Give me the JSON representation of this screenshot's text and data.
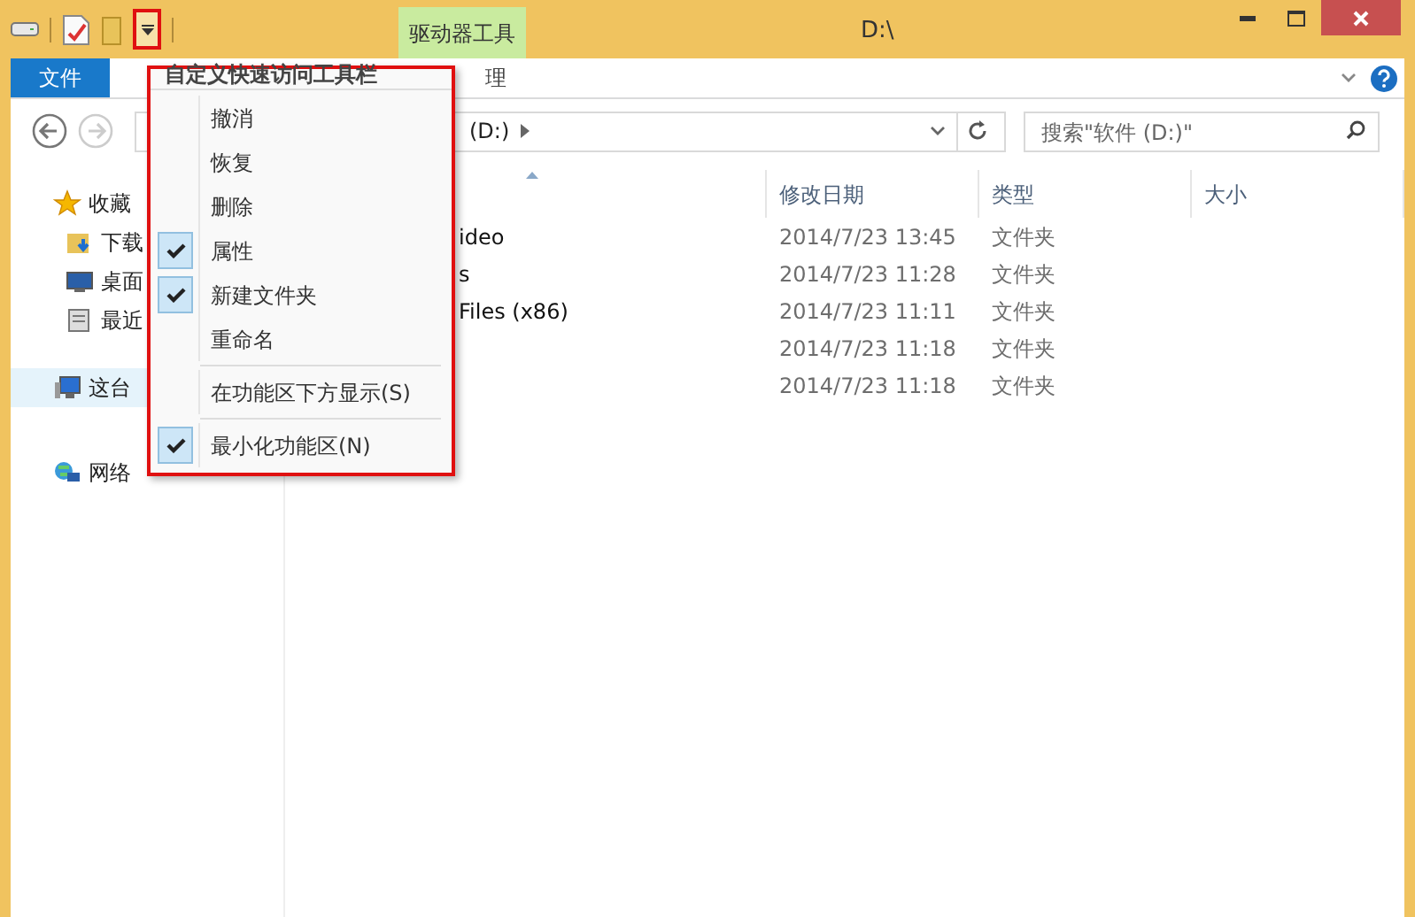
{
  "window": {
    "title": "D:\\",
    "context_tab": "驱动器工具"
  },
  "ribbon_tabs": [
    {
      "label": "文件",
      "selected": true
    },
    {
      "label": "理",
      "selected": false
    }
  ],
  "address": {
    "path": "(D:)",
    "search_placeholder": "搜索\"软件 (D:)\""
  },
  "nav": [
    {
      "label": "收藏",
      "kind": "star",
      "children": [
        {
          "label": "下载",
          "kind": "download"
        },
        {
          "label": "桌面",
          "kind": "desktop"
        },
        {
          "label": "最近",
          "kind": "recent"
        }
      ]
    },
    {
      "label": "这台",
      "kind": "pc",
      "selected": true
    },
    {
      "label": "网络",
      "kind": "network"
    }
  ],
  "columns": [
    "修改日期",
    "类型",
    "大小"
  ],
  "rows": [
    {
      "name": "ideo",
      "date": "2014/7/23 13:45",
      "type": "文件夹"
    },
    {
      "name": "s",
      "date": "2014/7/23 11:28",
      "type": "文件夹"
    },
    {
      "name": "Files (x86)",
      "date": "2014/7/23 11:11",
      "type": "文件夹"
    },
    {
      "date": "2014/7/23 11:18",
      "type": "文件夹"
    },
    {
      "date": "2014/7/23 11:18",
      "type": "文件夹"
    }
  ],
  "menu": {
    "title": "自定义快速访问工具栏",
    "items": [
      {
        "kind": "command",
        "label": "撤消",
        "checked": false
      },
      {
        "kind": "command",
        "label": "恢复",
        "checked": false
      },
      {
        "kind": "command",
        "label": "删除",
        "checked": false
      },
      {
        "kind": "command",
        "label": "属性",
        "checked": true
      },
      {
        "kind": "command",
        "label": "新建文件夹",
        "checked": true
      },
      {
        "kind": "command",
        "label": "重命名",
        "checked": false
      },
      {
        "kind": "separator"
      },
      {
        "kind": "command",
        "label": "在功能区下方显示(S)",
        "checked": false
      },
      {
        "kind": "separator"
      },
      {
        "kind": "command",
        "label": "最小化功能区(N)",
        "checked": true
      }
    ]
  }
}
